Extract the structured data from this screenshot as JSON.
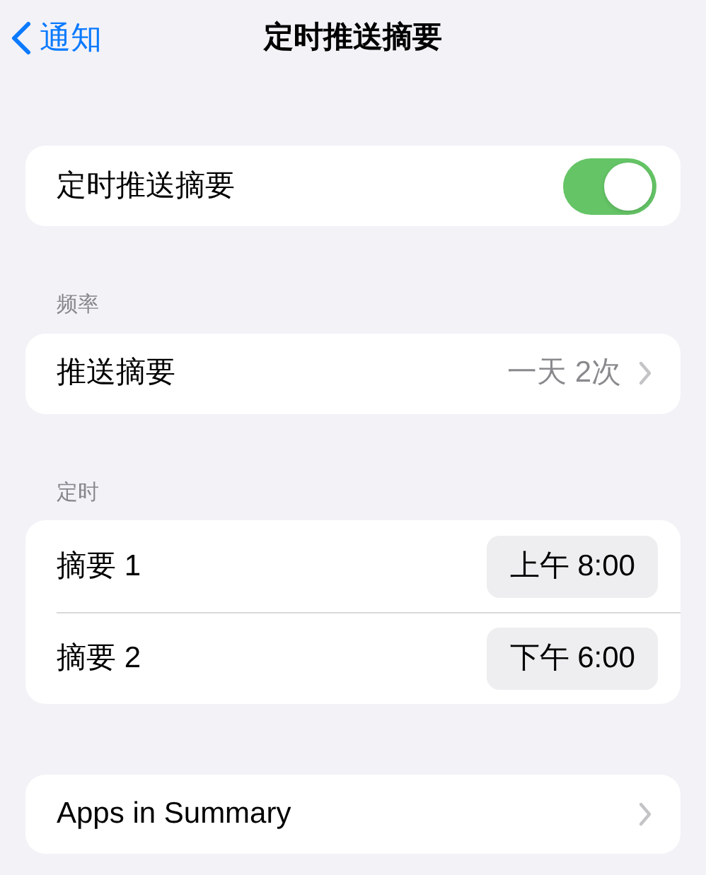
{
  "nav": {
    "back": "通知",
    "title": "定时推送摘要"
  },
  "toggle_row": {
    "label": "定时推送摘要",
    "on": true
  },
  "frequency": {
    "header": "频率",
    "label": "推送摘要",
    "value": "一天 2次"
  },
  "schedule": {
    "header": "定时",
    "rows": [
      {
        "label": "摘要 1",
        "time": "上午 8:00"
      },
      {
        "label": "摘要 2",
        "time": "下午 6:00"
      }
    ]
  },
  "apps_row": {
    "label": "Apps in Summary"
  }
}
